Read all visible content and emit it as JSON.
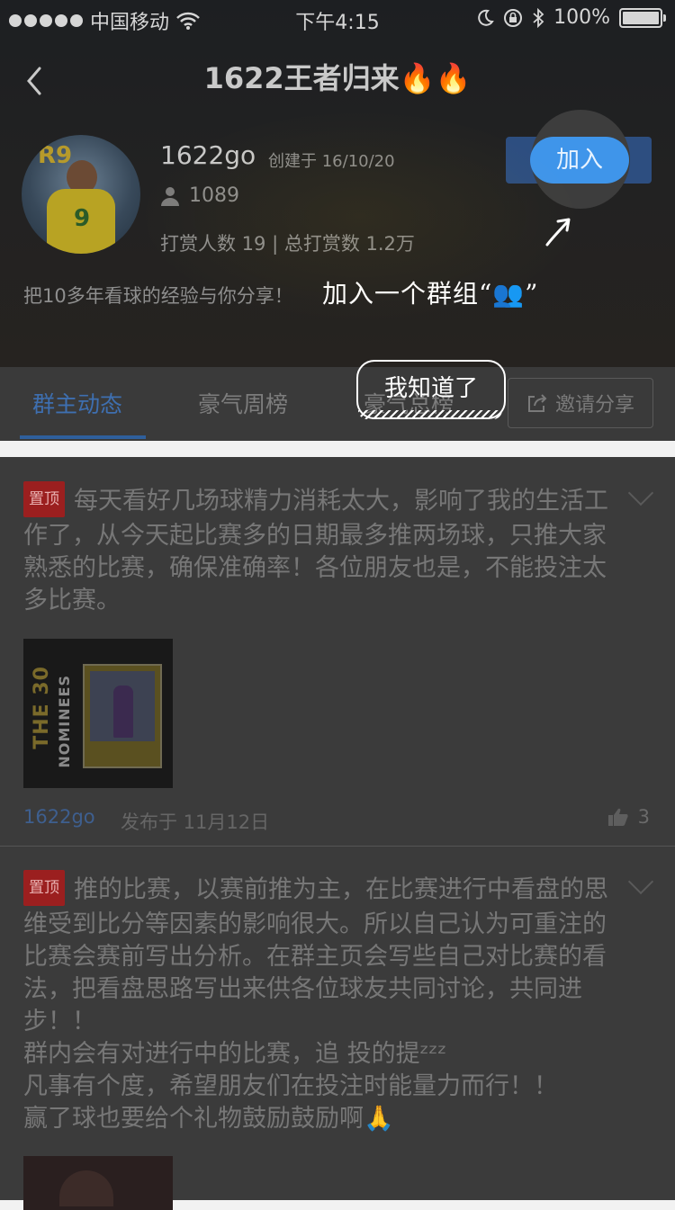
{
  "status_bar": {
    "carrier": "中国移动",
    "time": "下午4:15",
    "battery": "100%"
  },
  "nav": {
    "title": "1622王者归来🔥🔥"
  },
  "group": {
    "avatar_text": "R9",
    "avatar_number": "9",
    "name": "1622go",
    "created": "创建于 16/10/20",
    "member_count": "1089",
    "reward_stats": "打赏人数 19  |  总打赏数 1.2万",
    "description": "把10多年看球的经验与你分享！"
  },
  "join_button": {
    "label": "加入"
  },
  "onboarding": {
    "hint": "加入一个群组“👥”",
    "dismiss_label": "我知道了"
  },
  "tabs": [
    {
      "label": "群主动态",
      "active": true
    },
    {
      "label": "豪气周榜",
      "active": false
    },
    {
      "label": "豪气总榜",
      "active": false
    }
  ],
  "invite_button": {
    "label": "邀请分享"
  },
  "posts": [
    {
      "pinned_label": "置顶",
      "text": "每天看好几场球精力消耗太大，影响了我的生活工作了，从今天起比赛多的日期最多推两场球，只推大家熟悉的比赛，确保准确率！各位朋友也是，不能投注太多比赛。",
      "image_text": "THE 30",
      "image_subtext": "NOMINEES",
      "author": "1622go",
      "date": "发布于 11月12日",
      "likes": "3"
    },
    {
      "pinned_label": "置顶",
      "text": "推的比赛，以赛前推为主，在比赛进行中看盘的思维受到比分等因素的影响很大。所以自己认为可重注的比赛会赛前写出分析。在群主页会写些自己对比赛的看法，把看盘思路写出来供各位球友共同讨论，共同进步！！",
      "text2": "群内会有对进行中的比赛，追 投的提ᶻᶻᶻ",
      "text3": "凡事有个度，希望朋友们在投注时能量力而行！！",
      "text4": "赢了球也要给个礼物鼓励鼓励啊🙏"
    }
  ],
  "colors": {
    "accent_blue": "#3f95ea",
    "overlay_dark": "#3a3a3a",
    "pin_red": "#9b1f1f"
  }
}
